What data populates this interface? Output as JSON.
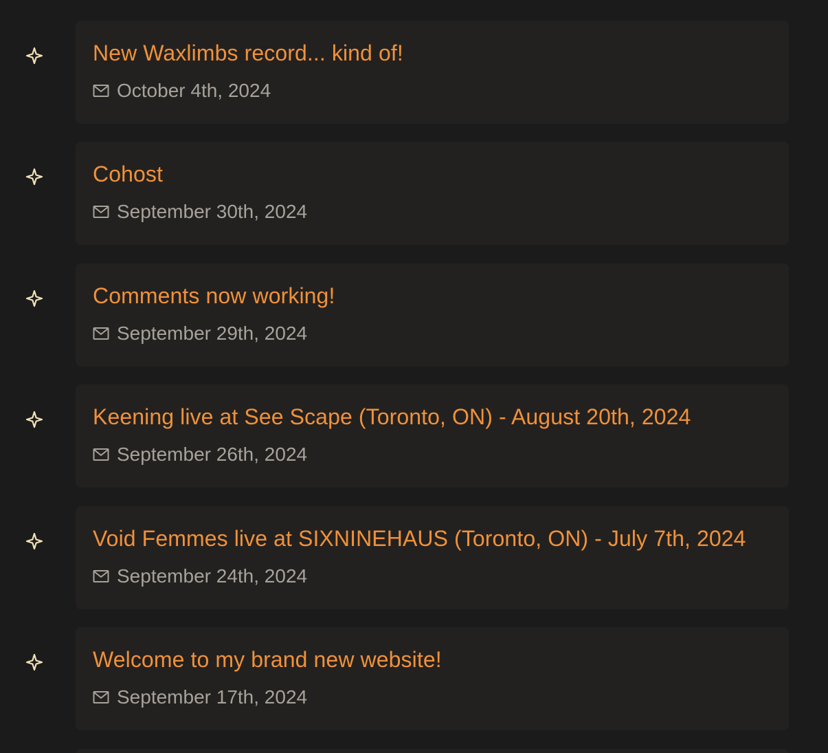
{
  "colors": {
    "background": "#1b1b1b",
    "card": "#232120",
    "title": "#f0913a",
    "meta": "#a7a29a",
    "bullet": "#f3e2b8"
  },
  "icons": {
    "bullet": "four-point-star-icon",
    "date": "mail-icon"
  },
  "posts": [
    {
      "title": "New Waxlimbs record... kind of!",
      "date": "October 4th, 2024"
    },
    {
      "title": "Cohost",
      "date": "September 30th, 2024"
    },
    {
      "title": "Comments now working!",
      "date": "September 29th, 2024"
    },
    {
      "title": "Keening live at See Scape (Toronto, ON) - August 20th, 2024",
      "date": "September 26th, 2024"
    },
    {
      "title": "Void Femmes live at SIXNINEHAUS (Toronto, ON) - July 7th, 2024",
      "date": "September 24th, 2024"
    },
    {
      "title": "Welcome to my brand new website!",
      "date": "September 17th, 2024"
    }
  ]
}
